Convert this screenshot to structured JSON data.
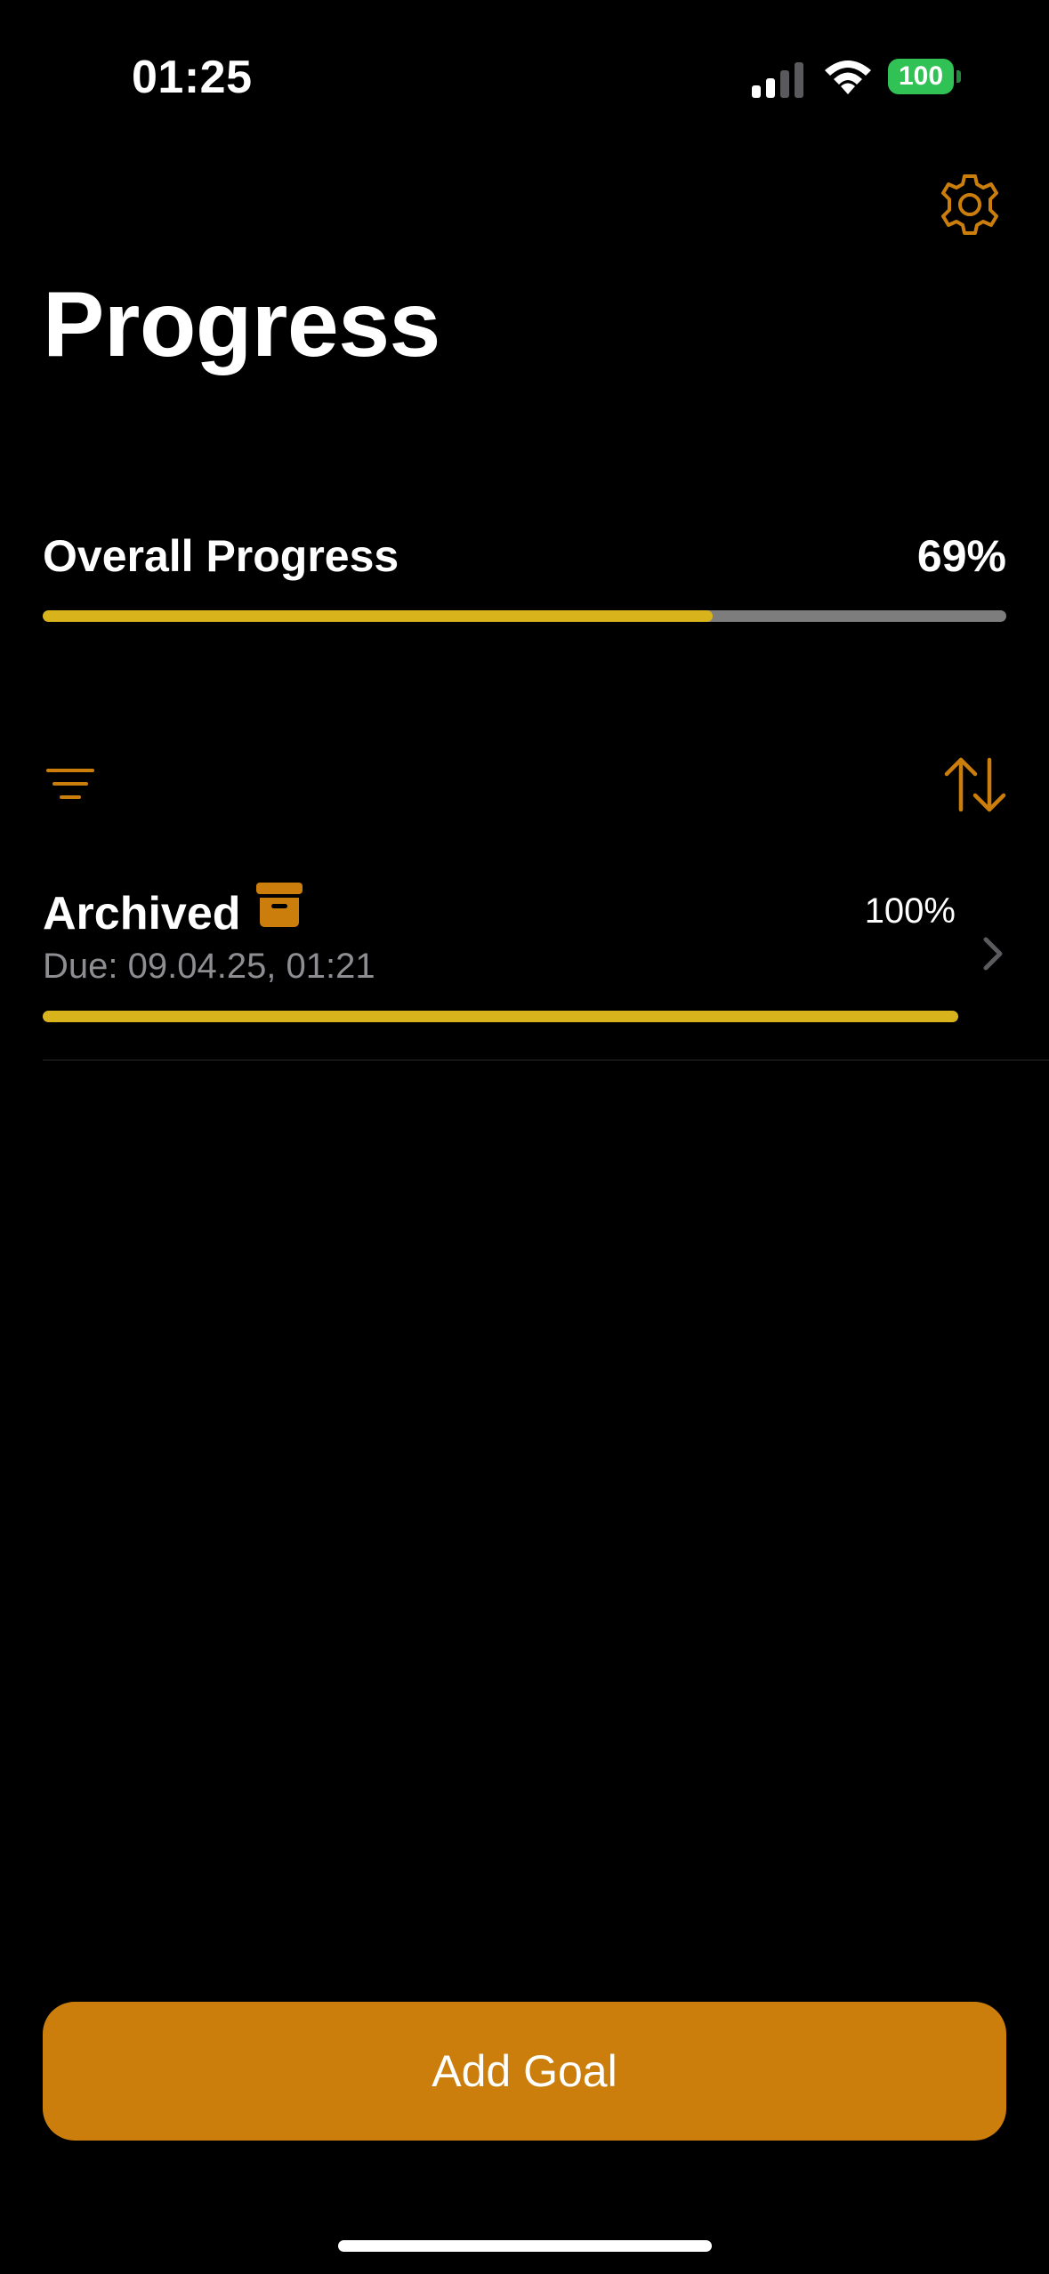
{
  "status_bar": {
    "time": "01:25",
    "battery": "100",
    "signal_icon": "cellular-signal-icon",
    "wifi_icon": "wifi-icon"
  },
  "header": {
    "title": "Progress",
    "settings_icon": "gear-icon"
  },
  "overall": {
    "label": "Overall Progress",
    "value": "69%",
    "fraction": 0.695
  },
  "toolbar": {
    "filter_icon": "filter-icon",
    "sort_icon": "sort-icon"
  },
  "goals": [
    {
      "title": "Archived",
      "status_icon": "archive-box-icon",
      "percent": "100%",
      "due": "Due: 09.04.25, 01:21",
      "fraction": 1.0
    }
  ],
  "actions": {
    "add_goal_label": "Add Goal"
  },
  "colors": {
    "accent": "#cb7e0b",
    "progress_fill": "#d9b31c",
    "progress_track": "#7d7d7d",
    "battery": "#30c254",
    "background": "#000000"
  }
}
